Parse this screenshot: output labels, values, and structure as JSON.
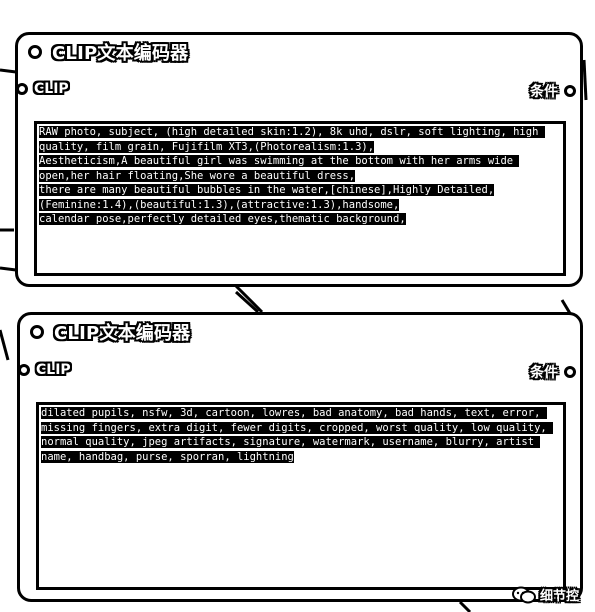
{
  "nodes": [
    {
      "title": "CLIP文本编码器",
      "input_label": "CLIP",
      "output_label": "条件",
      "text": "RAW photo, subject, (high detailed skin:1.2), 8k uhd, dslr, soft lighting, high quality, film grain, Fujifilm XT3,(Photorealism:1.3),\nAestheticism,A beautiful girl was swimming at the bottom with her arms wide open,her hair floating,She wore a beautiful dress,\nthere are many beautiful bubbles in the water,[chinese],Highly Detailed,(Feminine:1.4),(beautiful:1.3),(attractive:1.3),handsome,\ncalendar pose,perfectly detailed eyes,thematic background,"
    },
    {
      "title": "CLIP文本编码器",
      "input_label": "CLIP",
      "output_label": "条件",
      "text": "dilated pupils, nsfw, 3d, cartoon, lowres, bad anatomy, bad hands, text, error, missing fingers, extra digit, fewer digits, cropped, worst quality, low quality, normal quality, jpeg artifacts, signature, watermark, username, blurry, artist name, handbag, purse, sporran, lightning"
    }
  ],
  "watermark": {
    "icon": "wechat-icon",
    "text": "细节控"
  }
}
